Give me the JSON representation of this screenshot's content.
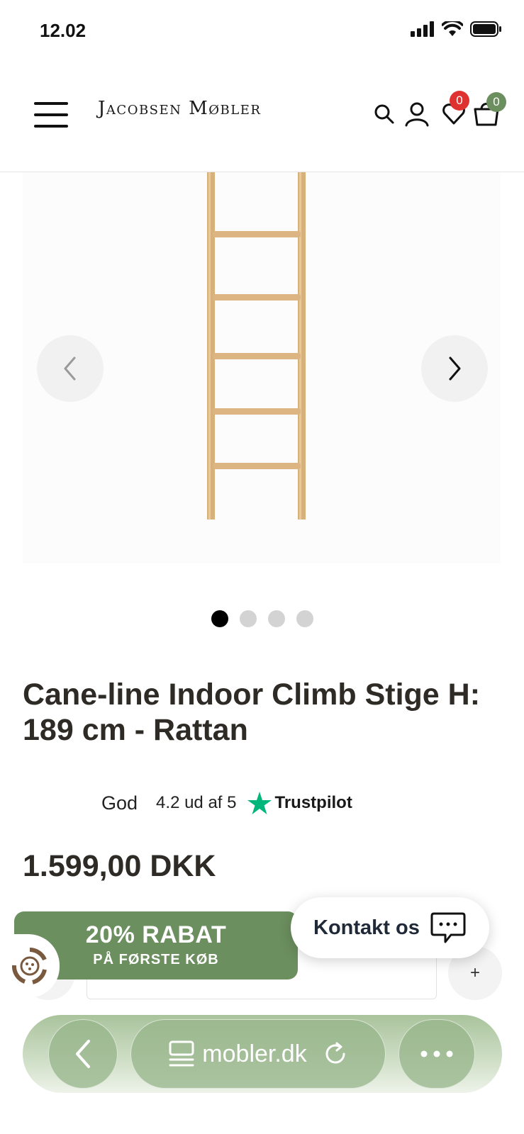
{
  "status": {
    "time": "12.02"
  },
  "header": {
    "logo": "Jacobsen Møbler",
    "wishlist_count": "0",
    "cart_count": "0",
    "wishlist_badge_color": "#e03131",
    "cart_badge_color": "#6b8f5e"
  },
  "gallery": {
    "image_count": 4,
    "active_index": 0
  },
  "product": {
    "title": "Cane-line Indoor Climb Stige H: 189 cm - Rattan",
    "rating_word": "God",
    "rating_score": "4.2 ud af 5",
    "trustpilot": "Trustpilot",
    "price": "1.599,00 DKK"
  },
  "quantity": {
    "plus_label": "+"
  },
  "discount": {
    "title": "20% RABAT",
    "subtitle": "PÅ FØRSTE KØB",
    "color": "#6b8f5e"
  },
  "contact": {
    "label": "Kontakt os"
  },
  "browser": {
    "url": "mobler.dk"
  },
  "colors": {
    "text": "#2e2a25",
    "trustpilot_green": "#00b67a",
    "accent_green": "#6b8f5e"
  }
}
